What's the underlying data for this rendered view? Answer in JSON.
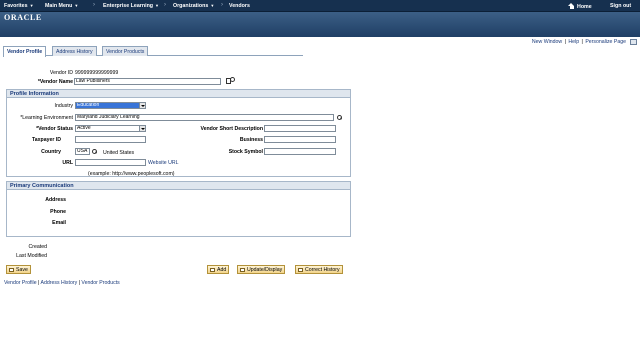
{
  "topnav": {
    "favorites": "Favorites",
    "main_menu": "Main Menu",
    "breadcrumb_1": "Enterprise Learning",
    "breadcrumb_2": "Organizations",
    "breadcrumb_3": "Vendors",
    "home": "Home",
    "sign_out": "Sign out"
  },
  "banner": {
    "logo": "ORACLE"
  },
  "pagelinks": {
    "new_window": "New Window",
    "help": "Help",
    "personalize": "Personalize Page"
  },
  "tabs": [
    "Vendor Profile",
    "Address History",
    "Vendor Products"
  ],
  "form": {
    "vendor_id_label": "Vendor ID",
    "vendor_id_value": "999999999999999",
    "vendor_name_label": "*Vendor Name",
    "vendor_name_value": "Law Publishers"
  },
  "profile": {
    "header": "Profile Information",
    "industry_label": "Industry",
    "industry_value": "Education",
    "learning_env_label": "*Learning Environment",
    "learning_env_value": "Maryland Judiciary Learning",
    "vendor_status_label": "*Vendor Status",
    "vendor_status_value": "Active",
    "taxpayer_label": "Taxpayer ID",
    "taxpayer_value": "",
    "country_label": "Country",
    "country_value": "USA",
    "country_desc": "United States",
    "url_label": "URL",
    "url_value": "",
    "website_link": "Website URL",
    "url_example": "(example: http://www.peoplesoft.com)",
    "short_desc_label": "Vendor Short Description",
    "short_desc_value": "",
    "business_label": "Business",
    "business_value": "",
    "stock_label": "Stock Symbol",
    "stock_value": ""
  },
  "communication": {
    "header": "Primary Communication",
    "address_label": "Address",
    "phone_label": "Phone",
    "email_label": "Email"
  },
  "audit": {
    "created_label": "Created",
    "modified_label": "Last Modified"
  },
  "buttons": {
    "save": "Save",
    "add": "Add",
    "update": "Update/Display",
    "correct": "Correct History"
  },
  "bottomlinks": [
    "Vendor Profile",
    "Address History",
    "Vendor Products"
  ],
  "colors": {
    "nav_bg": "#16304f",
    "banner_bg": "#2c4f78",
    "link": "#1a3a7a",
    "button": "#f2d48a"
  }
}
